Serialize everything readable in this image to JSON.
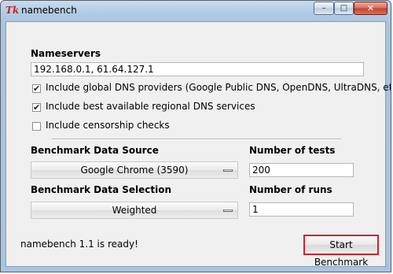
{
  "window": {
    "title": "namebench",
    "app_icon": "Tk",
    "controls": {
      "minimize_glyph": "–",
      "maximize_glyph": "□",
      "close_glyph": "✕"
    }
  },
  "nameservers": {
    "label": "Nameservers",
    "value": "192.168.0.1, 61.64.127.1"
  },
  "options": [
    {
      "label": "Include global DNS providers (Google Public DNS, OpenDNS, UltraDNS, etc.)",
      "checked": true,
      "mark": "✔"
    },
    {
      "label": "Include best available regional DNS services",
      "checked": true,
      "mark": "✔"
    },
    {
      "label": "Include censorship checks",
      "checked": false,
      "mark": ""
    }
  ],
  "data_source": {
    "label": "Benchmark Data Source",
    "value": "Google Chrome (3590)"
  },
  "data_selection": {
    "label": "Benchmark Data Selection",
    "value": "Weighted"
  },
  "num_tests": {
    "label": "Number of tests",
    "value": "200"
  },
  "num_runs": {
    "label": "Number of runs",
    "value": "1"
  },
  "status": {
    "text": "namebench 1.1 is ready!"
  },
  "actions": {
    "start_label": "Start Benchmark"
  },
  "colors": {
    "highlight_border": "#d0202a",
    "app_icon": "#c0261d"
  }
}
